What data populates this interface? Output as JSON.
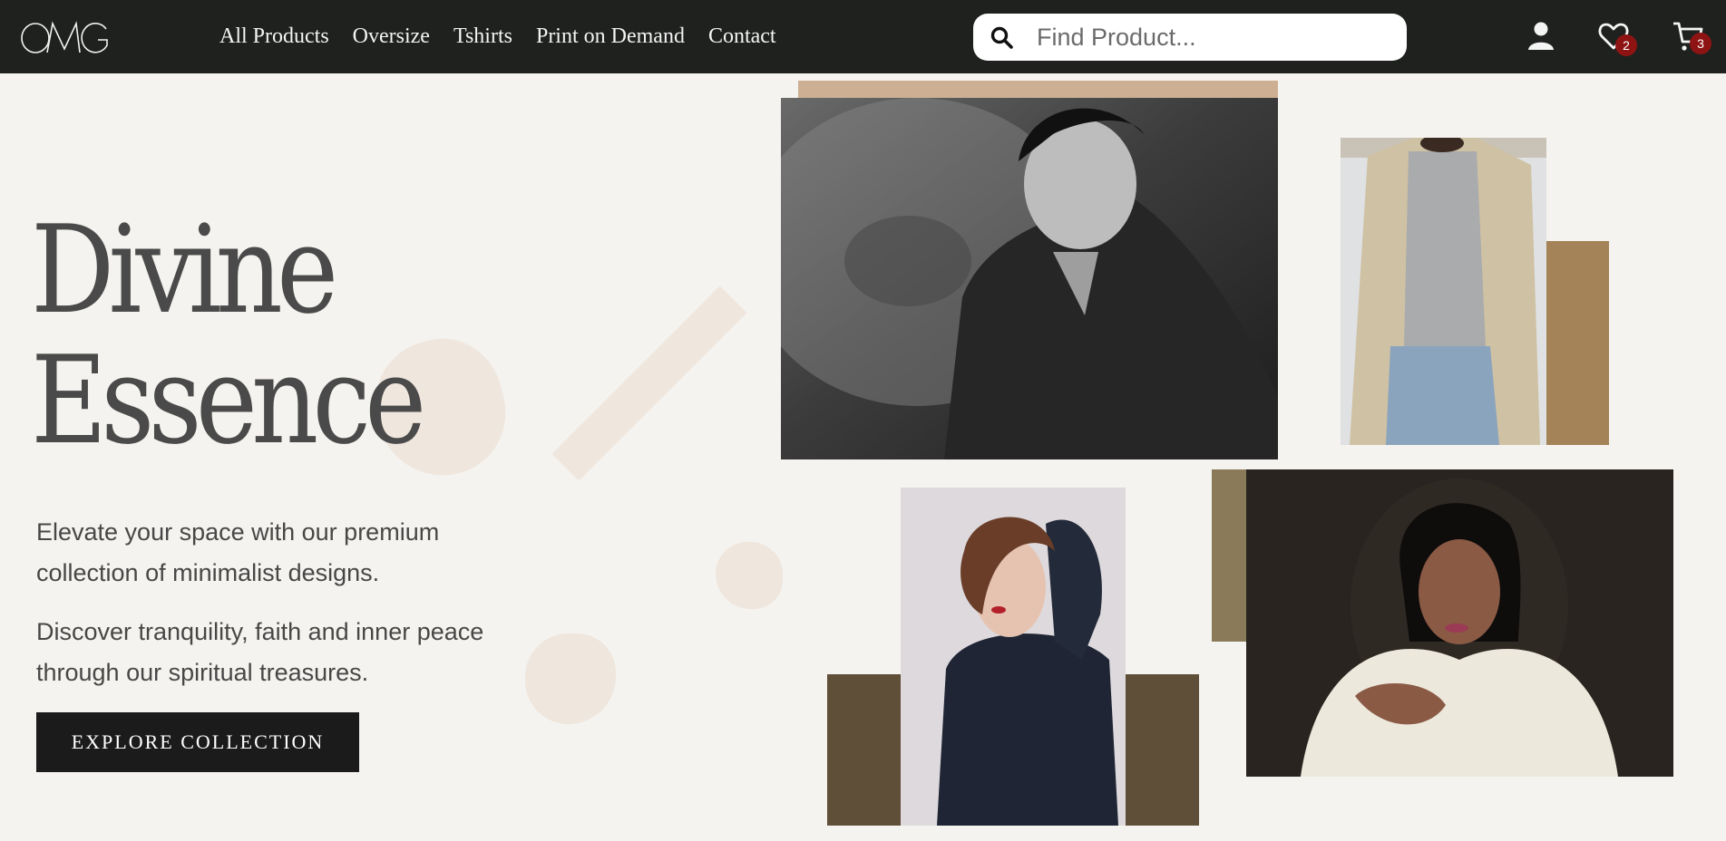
{
  "brand": {
    "logo": "OMG"
  },
  "nav": {
    "links": [
      "All Products",
      "Oversize",
      "Tshirts",
      "Print on Demand",
      "Contact"
    ]
  },
  "search": {
    "placeholder": "Find Product..."
  },
  "header_icons": {
    "account": "user-icon",
    "wishlist": {
      "icon": "heart-icon",
      "count": "2"
    },
    "cart": {
      "icon": "cart-icon",
      "count": "3"
    }
  },
  "hero": {
    "title_line1": "Divine",
    "title_line2": "Essence",
    "paragraph1": "Elevate your space with our premium collection of minimalist designs.",
    "paragraph2": "Discover tranquility, faith and inner peace through our spiritual treasures.",
    "cta_label": "EXPLORE COLLECTION"
  },
  "colors": {
    "header_bg": "#1e211e",
    "page_bg": "#f5f3ef",
    "badge": "#8e1414",
    "accent_tan": "#cdb093",
    "accent_brown": "#a58358",
    "accent_olive": "#8b7a5a",
    "accent_dark": "#5f4f38"
  }
}
